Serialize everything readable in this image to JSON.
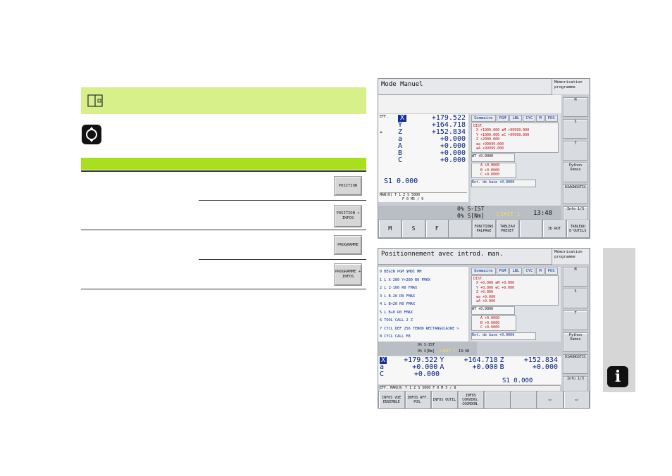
{
  "document": {
    "softkeys": [
      "POSITION",
      "POSITION + INFOS",
      "PROGRAMME",
      "PROGRAMME + INFOS"
    ]
  },
  "screen1": {
    "title": "Mode Manuel",
    "memo": "Mémorisation programme",
    "axes": [
      {
        "name": "X",
        "value": "+179.522"
      },
      {
        "name": "Y",
        "value": "+164.718"
      },
      {
        "name": "Z",
        "value": "+152.834"
      },
      {
        "name": "a",
        "value": "+0.000"
      },
      {
        "name": "A",
        "value": "+0.000"
      },
      {
        "name": "B",
        "value": "+0.000"
      },
      {
        "name": "C",
        "value": "+0.000"
      }
    ],
    "eff": "EFF.",
    "spindle": "S1   0.000",
    "status_row1": "MAN(0)  T 1       Z S 5000",
    "status_row2": "F 0        M5 / 9",
    "tabs": [
      "Sommaire",
      "PGM",
      "LBL",
      "CYC",
      "M",
      "POS"
    ],
    "dist_label": "DIST.",
    "dist_rows": [
      "X  +1000.000   ⊕M +99999.000",
      "Y  +1000.000   ⊕C +99999.000",
      "Z  +2000.000",
      "⊕a +99999.000",
      "⊕A +99999.000"
    ],
    "wt": "WT    +0.0000",
    "rot_rows": [
      "A  +0.0000",
      "B  +0.0000",
      "C  +0.0000"
    ],
    "rot_base": "Rot. de base   +0.0000",
    "overrides": [
      "0% S-IST",
      "0% S[Nm]"
    ],
    "limit": "LIMIT 1",
    "time": "13:48",
    "right_keys": [
      "M",
      "S",
      "T",
      "Python Demos",
      "DIAGNOSTIC",
      "Info 1/3"
    ],
    "bottom_keys": [
      "M",
      "S",
      "F",
      "",
      "FONCTIONS PALPAGE",
      "TABLEAU PRESET",
      "",
      "3D ROT",
      "TABLEAU D'OUTILS"
    ]
  },
  "screen2": {
    "title": "Positionnement avec introd. man.",
    "memo": "Mémorisation programme",
    "program": [
      "0  BEGIN PGM $MDI MM",
      "1  L  X-200  Y+200 R0 FMAX",
      "2  L  Z-100 R0 FMAX",
      "3  L  B-20 R0 FMAX",
      "4  L  B+20 R0 FMAX",
      "5  L  B+0 R0 FMAX",
      "6  TOOL CALL 2 Z",
      "7  CYCL DEF 256 TENON RECTANGULAIRE >",
      "8  CYCL CALL M3"
    ],
    "tabs": [
      "Sommaire",
      "PGM",
      "LBL",
      "CYC",
      "M",
      "POS"
    ],
    "dist_label": "DIST.",
    "dist_rows": [
      "X  +0.000   ⊕M +0.000",
      "Y  +0.000   ⊕C +0.000",
      "Z  +0.000",
      "⊕a +0.000",
      "⊕A +0.000"
    ],
    "wt": "WT    +0.0000",
    "rot_rows": [
      "A  +0.0000",
      "B  +0.0000",
      "C  +0.0000"
    ],
    "rot_base": "Rot. de base   +0.0000",
    "overrides": [
      "0% S-IST",
      "0% S[Nm]"
    ],
    "limit": "LIMIT 1",
    "time": "13:48",
    "axes_row1": [
      {
        "name": "X",
        "value": "+179.522"
      },
      {
        "name": "Y",
        "value": "+164.718"
      },
      {
        "name": "Z",
        "value": "+152.834"
      }
    ],
    "axes_row2": [
      {
        "name": "a",
        "value": "+0.000"
      },
      {
        "name": "A",
        "value": "+0.000"
      },
      {
        "name": "B",
        "value": "+0.000"
      }
    ],
    "axes_row3": [
      {
        "name": "C",
        "value": "+0.000"
      }
    ],
    "spindle": "S1   0.000",
    "eff": "EFF.",
    "status_row": "MAN(0)   T 1        Z S 5000   F 0      M 5 / 8",
    "right_keys": [
      "M",
      "S",
      "T",
      "Python Demos",
      "DIAGNOSTIC",
      "Info 1/3"
    ],
    "bottom_keys": [
      "INFOS VUE ENSEMBLE",
      "INFOS AFF. POS.",
      "INFOS OUTIL",
      "INFOS CONVERS. COORDON.",
      "",
      "",
      "⇦",
      "⇨"
    ]
  }
}
